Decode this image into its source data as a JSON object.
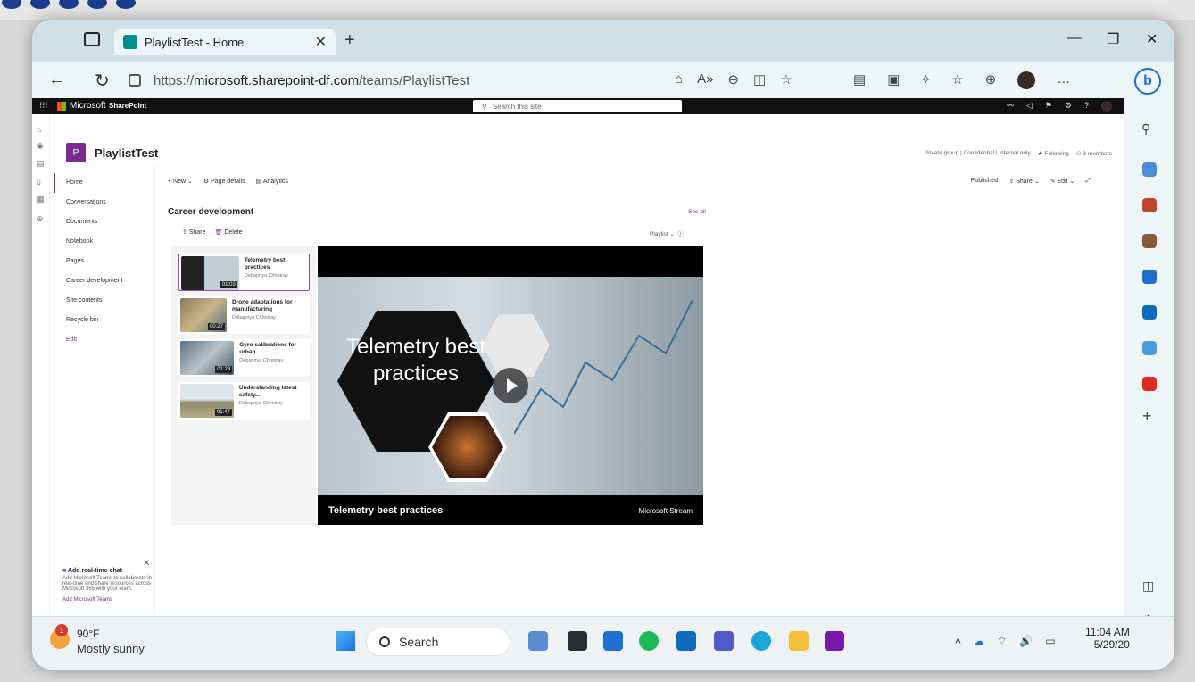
{
  "browser": {
    "tab_title": "PlaylistTest - Home",
    "url_prefix": "https://",
    "url_host": "microsoft.sharepoint-df.com",
    "url_path": "/teams/PlaylistTest"
  },
  "suite": {
    "brand": "Microsoft",
    "app": "SharePoint",
    "search_placeholder": "Search this site"
  },
  "site": {
    "logo_letter": "P",
    "title": "PlaylistTest",
    "classification": "Private group | Confidential \\ Internal only",
    "following": "Following",
    "members": "3 members"
  },
  "nav": [
    {
      "label": "Home"
    },
    {
      "label": "Conversations"
    },
    {
      "label": "Documents"
    },
    {
      "label": "Notebook"
    },
    {
      "label": "Pages"
    },
    {
      "label": "Career development"
    },
    {
      "label": "Site contents"
    },
    {
      "label": "Recycle bin"
    },
    {
      "label": "Edit"
    }
  ],
  "cmdbar": {
    "new": "New",
    "page_details": "Page details",
    "analytics": "Analytics",
    "published": "Published",
    "share": "Share",
    "edit": "Edit"
  },
  "section": {
    "title": "Career development",
    "see_all": "See all",
    "share": "Share",
    "delete": "Delete",
    "view": "Playlist"
  },
  "playlist": [
    {
      "title": "Telemetry best practices",
      "author": "Debapriya Chhotray",
      "duration": "01:03"
    },
    {
      "title": "Drone adaptations for manufacturing",
      "author": "Debapriya Chhotray",
      "duration": "00:27"
    },
    {
      "title": "Gyro calibrations for urban...",
      "author": "Debapriya Chhotray",
      "duration": "01:23"
    },
    {
      "title": "Understanding latest safety...",
      "author": "Debapriya Chhotray",
      "duration": "01:47"
    }
  ],
  "player": {
    "overlay_title": "Telemetry best practices",
    "caption": "Telemetry best practices",
    "brand": "Microsoft Stream"
  },
  "chat_promo": {
    "title": "Add real-time chat",
    "body": "Add Microsoft Teams to collaborate in real-time and share resources across Microsoft 365 with your team.",
    "link": "Add Microsoft Teams"
  },
  "taskbar": {
    "weather_badge": "1",
    "temperature": "90°F",
    "condition": "Mostly sunny",
    "search": "Search",
    "time": "11:04 AM",
    "date": "5/29/20"
  }
}
